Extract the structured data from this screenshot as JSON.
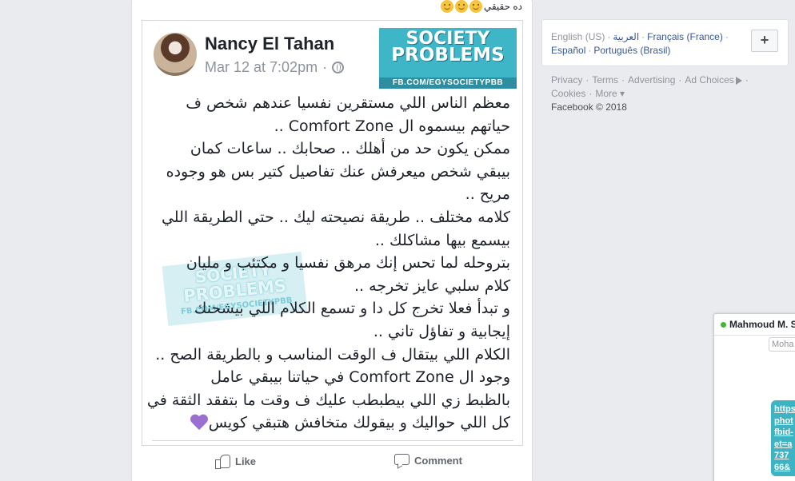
{
  "post": {
    "caption": "ده حقيقي",
    "caption_emojis": [
      "smile-emoji",
      "smile-emoji",
      "smile-emoji"
    ],
    "author": "Nancy El Tahan",
    "timestamp": "Mar 12 at 7:02pm",
    "timestamp_separator": "·",
    "logo": {
      "line1": "SOCIETY",
      "line2": "PROBLEMS",
      "url": "FB.COM/EGYSOCIETYPBB"
    },
    "watermark": {
      "line1": "SOCIETY",
      "line2": "PROBLEMS",
      "url": "FB.COM/EGYSOCIETYPBB"
    },
    "body_lines": [
      "معظم الناس اللي مستقرين نفسيا عندهم شخص ف",
      "حياتهم بيسموه ال Comfort Zone ..",
      "ممكن يكون حد من أهلك .. صحابك .. ساعات كمان",
      "بيبقي شخص ميعرفش عنك تفاصيل كتير بس هو وجوده",
      "مريح ..",
      "كلامه مختلف .. طريقة نصيحته ليك .. حتي الطريقة اللي",
      "بيسمع بيها مشاكلك ..",
      "بتروحله لما تحس إنك مرهق نفسيا و مكتئب و مليان",
      "كلام سلبي عايز تخرجه ..",
      "و تبدأ فعلا تخرج كل دا و تسمع الكلام اللي بيشحنك",
      "إيجابية و تفاؤل تاني ..",
      "الكلام اللي بيتقال ف الوقت المناسب و بالطريقة الصح ..",
      "وجود ال Comfort Zone  في حياتنا بيبقي عامل",
      "بالظبط زي اللي بيطبطب عليك ف وقت ما بتفقد الثقة في",
      "كل اللي حواليك و بيقولك متخافش هتبقي كويس"
    ],
    "like_label": "Like",
    "comment_label": "Comment"
  },
  "sidebar": {
    "languages": [
      {
        "label": "English (US)",
        "active": false
      },
      {
        "label": "العربية",
        "active": true
      },
      {
        "label": "Français (France)",
        "active": true
      },
      {
        "label": "Español",
        "active": true
      },
      {
        "label": "Português (Brasil)",
        "active": true
      }
    ],
    "plus_label": "+",
    "footer_links": [
      "Privacy",
      "Terms",
      "Advertising",
      "Ad Choices",
      "Cookies",
      "More"
    ],
    "copyright": "Facebook © 2018"
  },
  "chat": {
    "name": "Mahmoud M. So",
    "chip_text": "Moha",
    "link_lines": [
      "https",
      "phot",
      "fbid-",
      "et=a",
      "737",
      "66&"
    ]
  },
  "colors": {
    "page_bg": "#e9ebee",
    "link_blue": "#365899",
    "brand_teal": "#3fb6c8",
    "online_green": "#42b72a",
    "heart_purple": "#9b6fcf"
  }
}
